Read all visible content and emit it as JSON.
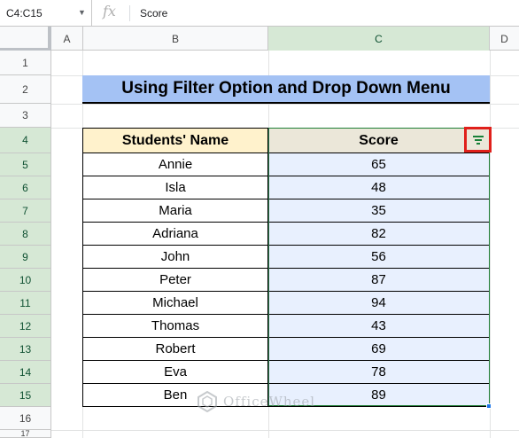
{
  "formula_bar": {
    "name_box": "C4:C15",
    "fx_label": "fx",
    "formula": "Score"
  },
  "columns": [
    "A",
    "B",
    "C",
    "D"
  ],
  "rows": [
    "1",
    "2",
    "3",
    "4",
    "5",
    "6",
    "7",
    "8",
    "9",
    "10",
    "11",
    "12",
    "13",
    "14",
    "15",
    "16",
    "17"
  ],
  "title": "Using Filter Option and Drop Down Menu",
  "table": {
    "headers": [
      "Students' Name",
      "Score"
    ],
    "rows": [
      {
        "name": "Annie",
        "score": "65"
      },
      {
        "name": "Isla",
        "score": "48"
      },
      {
        "name": "Maria",
        "score": "35"
      },
      {
        "name": "Adriana",
        "score": "82"
      },
      {
        "name": "John",
        "score": "56"
      },
      {
        "name": "Peter",
        "score": "87"
      },
      {
        "name": "Michael",
        "score": "94"
      },
      {
        "name": "Thomas",
        "score": "43"
      },
      {
        "name": "Robert",
        "score": "69"
      },
      {
        "name": "Eva",
        "score": "78"
      },
      {
        "name": "Ben",
        "score": "89"
      }
    ]
  },
  "filter_button": {
    "icon": "filter-icon",
    "highlight_color": "#e0201b"
  },
  "watermark": {
    "text": "OfficeWheel"
  },
  "colors": {
    "title_bg": "#a4c2f4",
    "name_header_bg": "#fff2cc",
    "score_header_bg": "#ebe7d9",
    "selection_bg": "#e8f0fe",
    "selected_header": "#d6e8d5"
  }
}
